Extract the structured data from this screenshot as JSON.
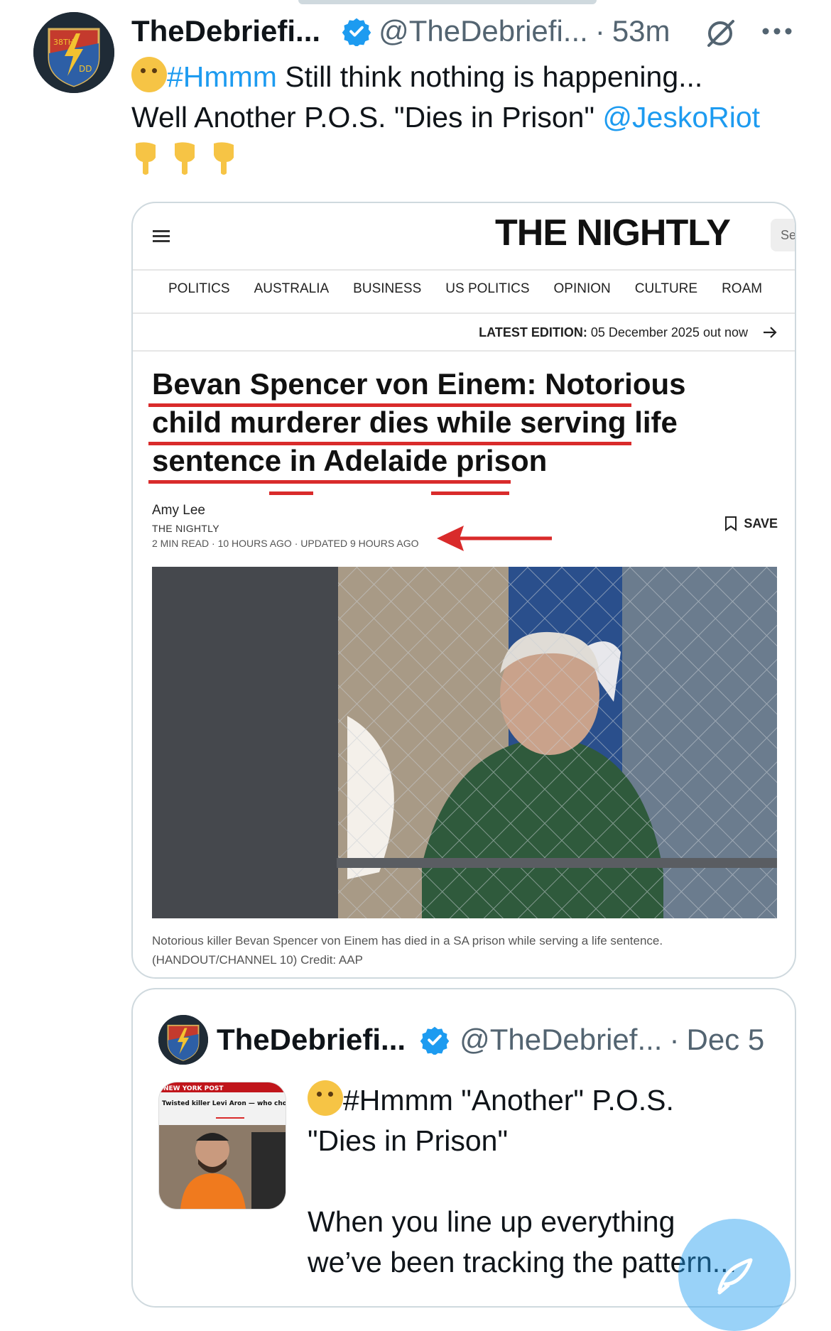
{
  "tweet": {
    "display_name": "TheDebriefi...",
    "handle": "@TheDebriefi...",
    "separator": "·",
    "time": "53m",
    "hashtag": "#Hmmm",
    "text_1": " Still think nothing is happening...",
    "text_2": "Well Another P.O.S. \"Dies in Prison\" ",
    "mention": "@JeskoRiot",
    "avatar_badge_text": "38TH",
    "avatar_badge_text_2": "DD",
    "avatar_ring_text": "38th DIGITAL DIVISION"
  },
  "article": {
    "logo": "THE NIGHTLY",
    "search_stub": "Se",
    "nav": [
      "POLITICS",
      "AUSTRALIA",
      "BUSINESS",
      "US POLITICS",
      "OPINION",
      "CULTURE",
      "ROAM"
    ],
    "edition_label": "LATEST EDITION:",
    "edition_value": " 05 December 2025 out now",
    "headline_1": "Bevan Spencer von Einem: Notorious",
    "headline_2": "child murderer dies while serving life",
    "headline_3": "sentence in Adelaide prison",
    "author": "Amy Lee",
    "outlet": "THE NIGHTLY",
    "meta": "2 MIN READ  ·  10 HOURS AGO  ·  UPDATED 9 HOURS AGO",
    "save_label": "SAVE",
    "caption": "Notorious killer Bevan Spencer von Einem has died in a SA prison while serving a life sentence. (HANDOUT/CHANNEL 10) Credit: AAP"
  },
  "quote": {
    "display_name": "TheDebriefi...",
    "handle": "@TheDebrief...",
    "separator": "·",
    "date": "Dec 5",
    "hashtag_line": "#Hmmm \"Another\" P.O.S.",
    "line_2": "\"Dies in Prison\"",
    "line_3": "When you line up everything\nwe’ve been tracking the pattern...",
    "thumb_masthead": "NEW YORK POST",
    "thumb_headline": "Twisted killer Levi Aron — who chopped up, dumped body of Leiby Kletzky, 8, in 2011 — dies behind bars"
  },
  "colors": {
    "link": "#1d9bf0",
    "secondary_text": "#536471",
    "border": "#cfd9de",
    "annotation_red": "#d92b2b"
  },
  "icons": {
    "verified": "verified-badge-icon",
    "grok": "grok-icon",
    "more": "more-dots-icon",
    "menu": "hamburger-menu-icon",
    "arrow": "arrow-right-icon",
    "save": "bookmark-icon",
    "compose": "compose-post-icon"
  }
}
